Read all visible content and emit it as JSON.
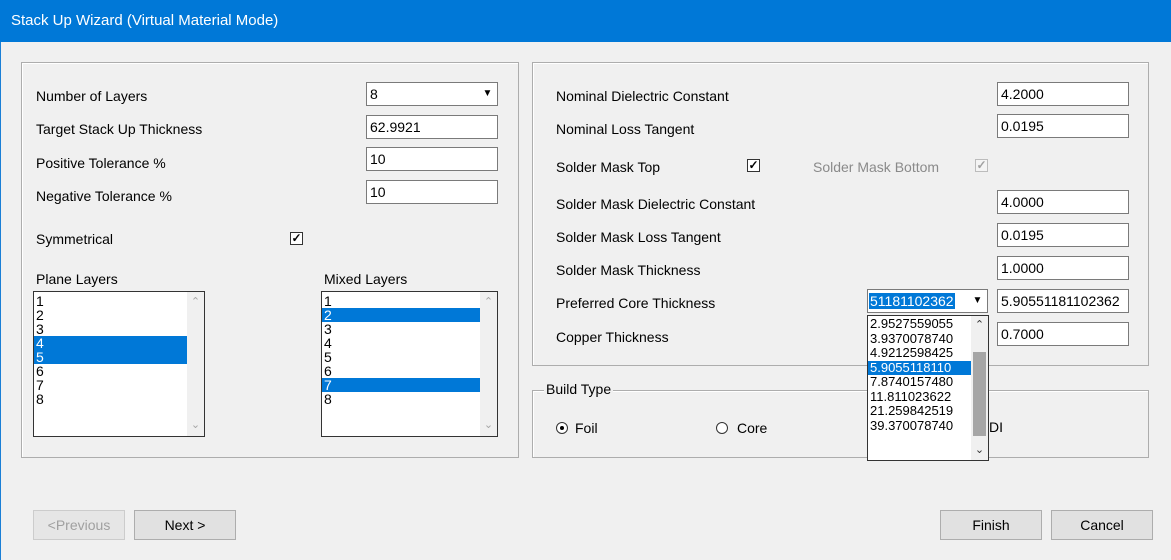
{
  "window": {
    "title": "Stack Up Wizard (Virtual Material Mode)"
  },
  "left": {
    "num_layers_label": "Number of Layers",
    "num_layers_value": "8",
    "target_thickness_label": "Target Stack Up Thickness",
    "target_thickness_value": "62.9921",
    "pos_tol_label": "Positive Tolerance %",
    "pos_tol_value": "10",
    "neg_tol_label": "Negative Tolerance %",
    "neg_tol_value": "10",
    "symmetrical_label": "Symmetrical",
    "symmetrical_checked": true,
    "plane_layers_label": "Plane Layers",
    "plane_layers": [
      {
        "v": "1",
        "sel": false
      },
      {
        "v": "2",
        "sel": false
      },
      {
        "v": "3",
        "sel": false
      },
      {
        "v": "4",
        "sel": true
      },
      {
        "v": "5",
        "sel": true
      },
      {
        "v": "6",
        "sel": false
      },
      {
        "v": "7",
        "sel": false
      },
      {
        "v": "8",
        "sel": false
      }
    ],
    "mixed_layers_label": "Mixed Layers",
    "mixed_layers": [
      {
        "v": "1",
        "sel": false
      },
      {
        "v": "2",
        "sel": true
      },
      {
        "v": "3",
        "sel": false
      },
      {
        "v": "4",
        "sel": false
      },
      {
        "v": "5",
        "sel": false
      },
      {
        "v": "6",
        "sel": false
      },
      {
        "v": "7",
        "sel": true
      },
      {
        "v": "8",
        "sel": false
      }
    ]
  },
  "right": {
    "dielectric_label": "Nominal Dielectric Constant",
    "dielectric_value": "4.2000",
    "loss_tangent_label": "Nominal Loss Tangent",
    "loss_tangent_value": "0.0195",
    "sm_top_label": "Solder Mask Top",
    "sm_bottom_label": "Solder Mask Bottom",
    "sm_dielectric_label": "Solder Mask Dielectric Constant",
    "sm_dielectric_value": "4.0000",
    "sm_loss_label": "Solder Mask Loss Tangent",
    "sm_loss_value": "0.0195",
    "sm_thickness_label": "Solder Mask Thickness",
    "sm_thickness_value": "1.0000",
    "core_label": "Preferred Core Thickness",
    "core_combo_value": "51181102362",
    "core_text_value": "5.90551181102362",
    "copper_label": "Copper Thickness",
    "copper_value": "0.7000",
    "core_options": [
      {
        "v": "2.9527559055",
        "sel": false
      },
      {
        "v": "3.9370078740",
        "sel": false
      },
      {
        "v": "4.9212598425",
        "sel": false
      },
      {
        "v": "5.9055118110",
        "sel": true
      },
      {
        "v": "7.8740157480",
        "sel": false
      },
      {
        "v": "11.811023622",
        "sel": false
      },
      {
        "v": "21.259842519",
        "sel": false
      },
      {
        "v": "39.370078740",
        "sel": false
      }
    ]
  },
  "build_type": {
    "legend": "Build Type",
    "foil_label": "Foil",
    "core_label": "Core",
    "hdi_fragment": "DI"
  },
  "buttons": {
    "previous": "<Previous",
    "next": "Next >",
    "finish": "Finish",
    "cancel": "Cancel"
  },
  "icons": {
    "dropdown": "chevron-down-icon",
    "check": "checkmark-icon",
    "scroll_up": "chevron-up-icon",
    "scroll_down": "chevron-down-icon"
  }
}
